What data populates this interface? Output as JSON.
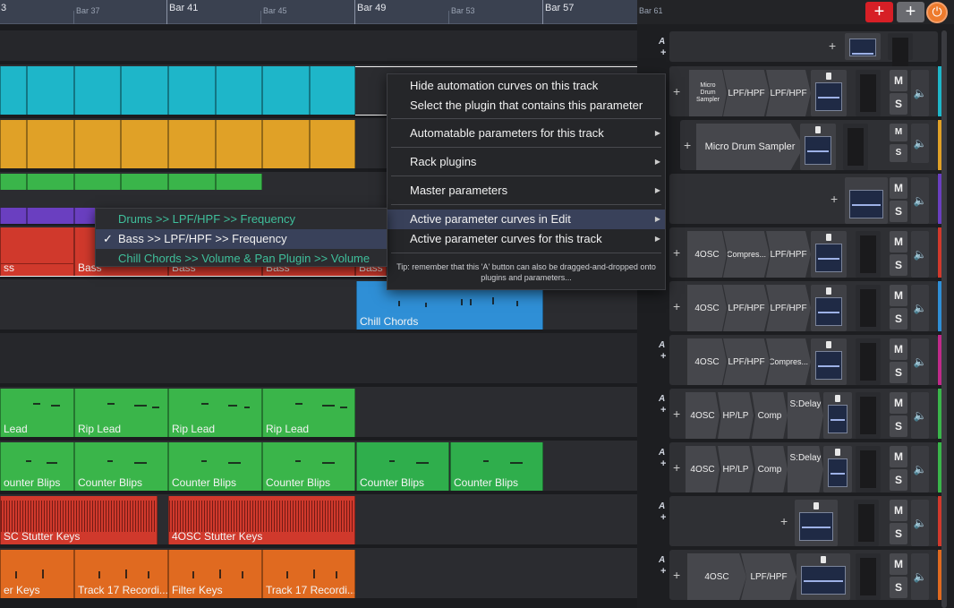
{
  "ruler": {
    "bars_major": [
      "Bar 41",
      "Bar 49",
      "Bar 57"
    ],
    "bars_minor": [
      "Bar 37",
      "Bar 45",
      "Bar 53",
      "Bar 61"
    ],
    "first_label": "3",
    "add_button": "+",
    "add_grey_button": "+",
    "power_icon": "⏻"
  },
  "context_menu": {
    "items": [
      "Hide automation curves on this track",
      "Select the plugin that contains this parameter",
      "Automatable parameters for this track",
      "Rack plugins",
      "Master parameters",
      "Active parameter curves in Edit",
      "Active parameter curves for this track"
    ],
    "tip": "Tip: remember that this 'A' button can also be dragged-and-dropped onto plugins and parameters...",
    "arrow": "▶"
  },
  "submenu": {
    "items": [
      "Drums >> LPF/HPF >> Frequency",
      "Bass >> LPF/HPF >> Frequency",
      "Chill Chords >> Volume & Pan Plugin >> Volume"
    ],
    "check": "✓"
  },
  "clips": {
    "bass": "Bass",
    "chill": "Chill Chords",
    "rip": "Rip Lead",
    "lead_cut": "Lead",
    "counter": "Counter Blips",
    "counter_cut": "ounter Blips",
    "stutter": "4OSC Stutter Keys",
    "stutter_cut": "SC Stutter Keys",
    "track17": "Track 17 Recordi...",
    "filter": "Filter Keys",
    "keys_cut": "er Keys",
    "bass_cut": "ss",
    "automation_hint": "Bass >> LPF/HPF >> Frequency"
  },
  "headers": {
    "a": "A",
    "plus": "+",
    "m": "M",
    "s": "S",
    "speaker": "🔈",
    "plugins": {
      "micro_drum_sampler": "Micro Drum Sampler",
      "micro_drum_sampler_small": "Micro\nDrum\nSampler",
      "lpf_hpf": "LPF/HPF",
      "osc": "4OSC",
      "compressor": "Compres...",
      "hp_lp": "HP/LP",
      "comp": "Comp",
      "sdelay": "S:Delay"
    }
  },
  "colors": {
    "cyan": "#1eb6c9",
    "amber": "#e0a127",
    "green": "#3ab54a",
    "purple": "#6a3fc0",
    "red": "#d0392c",
    "blue": "#2f8fd6",
    "orange": "#e06a20",
    "bright_green": "#2fae4c"
  }
}
